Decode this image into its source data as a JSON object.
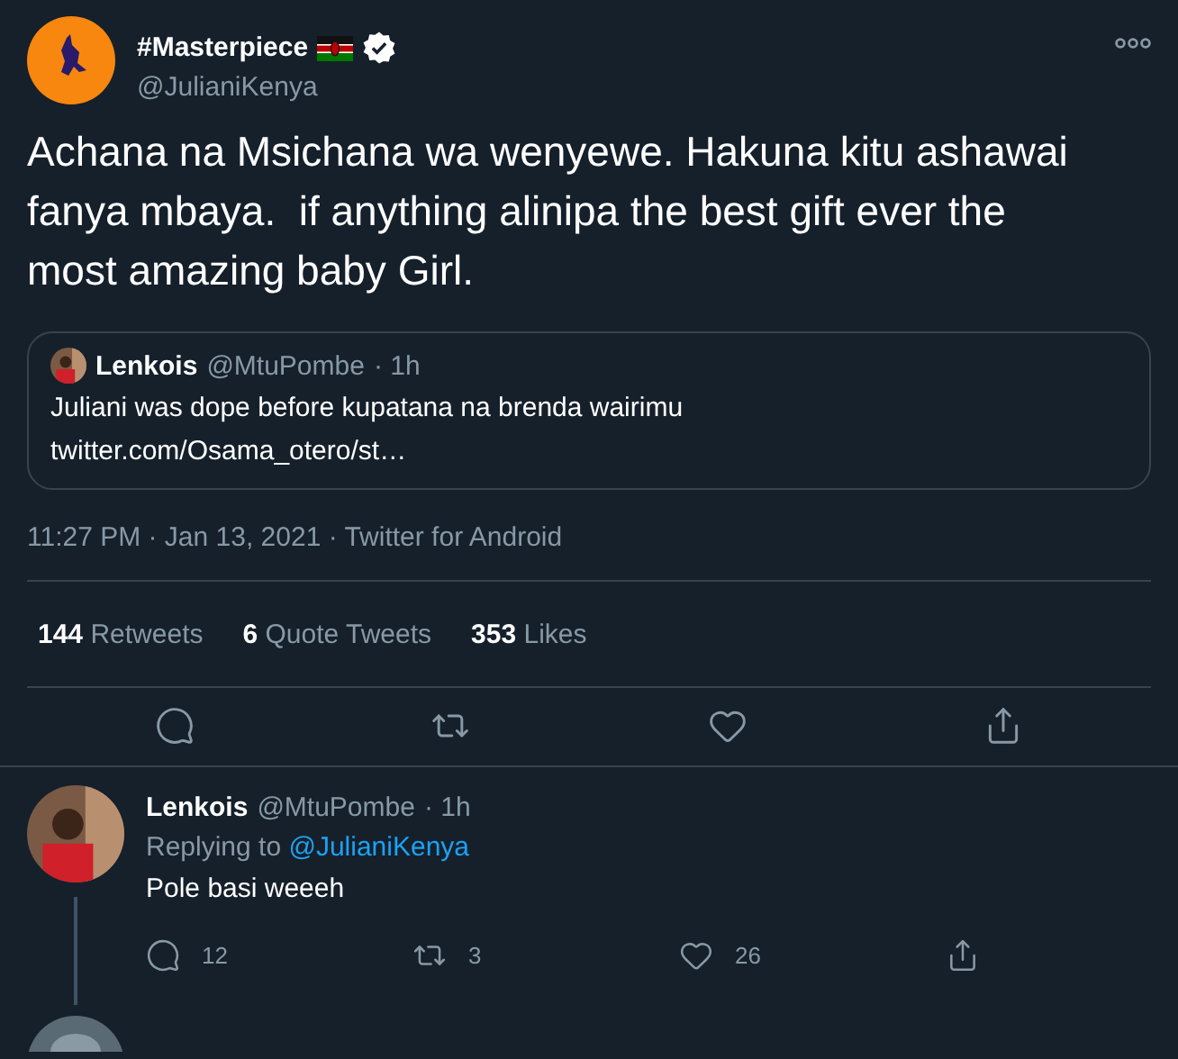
{
  "tweet": {
    "name": "#Masterpiece",
    "handle": "@JulianiKenya",
    "verified": true,
    "text": "Achana na Msichana wa wenyewe. Hakuna kitu ashawai fanya mbaya.  if anything alinipa the best gift ever the most amazing baby Girl.",
    "quote": {
      "name": "Lenkois",
      "handle": "@MtuPombe",
      "time": "· 1h",
      "text": "Juliani was dope before kupatana na brenda wairimu",
      "link": "twitter.com/Osama_otero/st…"
    },
    "timestamp": "11:27 PM · Jan 13, 2021 · Twitter for Android",
    "stats": [
      {
        "count": "144",
        "label": "Retweets"
      },
      {
        "count": "6",
        "label": "Quote Tweets"
      },
      {
        "count": "353",
        "label": "Likes"
      }
    ],
    "actions": [
      {
        "kind": "reply"
      },
      {
        "kind": "retweet"
      },
      {
        "kind": "like"
      },
      {
        "kind": "share"
      }
    ]
  },
  "reply": {
    "name": "Lenkois",
    "handle": "@MtuPombe",
    "time": "· 1h",
    "replying_label": "Replying to",
    "replying_to": "@JulianiKenya",
    "text": "Pole basi weeeh",
    "actions": [
      {
        "kind": "reply",
        "count": "12"
      },
      {
        "kind": "retweet",
        "count": "3"
      },
      {
        "kind": "like",
        "count": "26"
      },
      {
        "kind": "share"
      }
    ]
  }
}
